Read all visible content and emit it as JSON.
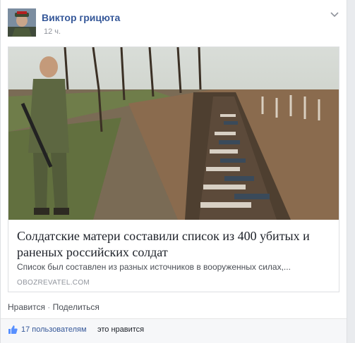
{
  "post": {
    "author": "Виктор грицюта",
    "time": "12 ч."
  },
  "link_card": {
    "title": "Солдатские матери составили список из 400 убитых и раненых российских солдат",
    "description": "Список был составлен из разных источников в вооруженных силах,...",
    "source": "OBOZREVATEL.COM"
  },
  "actions": {
    "like": "Нравится",
    "separator": " · ",
    "share": "Поделиться"
  },
  "likes": {
    "count_text": "17 пользователям",
    "suffix": "это нравится"
  },
  "icons": {
    "menu": "chevron-down-icon",
    "like": "thumbs-up-icon"
  },
  "colors": {
    "link": "#365899",
    "text": "#1d2129",
    "secondary": "#90949c"
  }
}
